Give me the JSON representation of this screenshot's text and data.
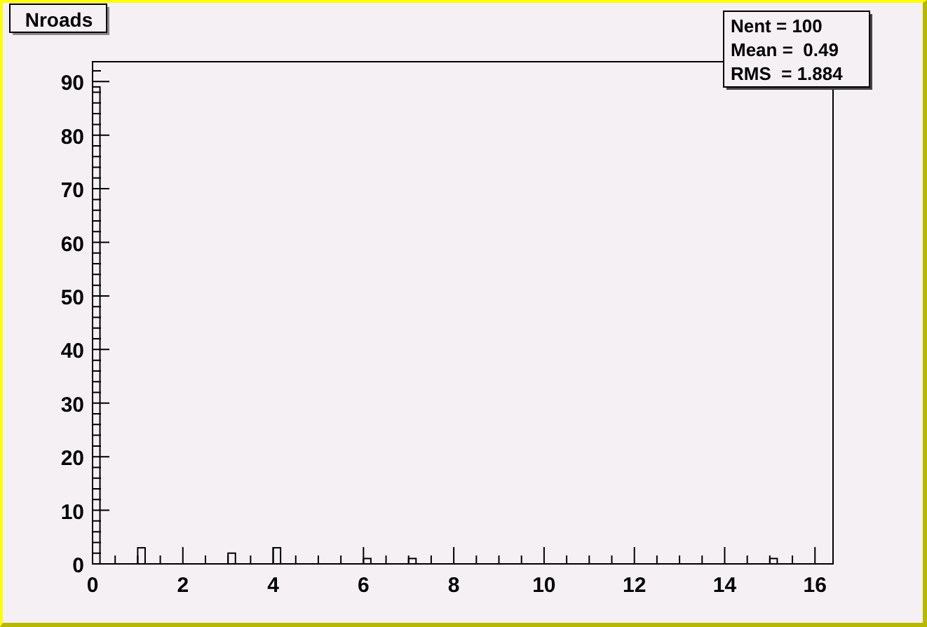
{
  "title": "Nroads",
  "stats": [
    "Nent = 100",
    "Mean =  0.49",
    "RMS  = 1.884"
  ],
  "chart_data": {
    "type": "bar",
    "x": [
      0,
      1,
      3,
      4,
      6,
      7,
      15
    ],
    "values": [
      89,
      3,
      2,
      3,
      1,
      1,
      1
    ],
    "xlim": [
      0,
      16.4
    ],
    "ylim": [
      0,
      93.7
    ],
    "xticks": [
      0,
      2,
      4,
      6,
      8,
      10,
      12,
      14,
      16
    ],
    "yticks": [
      0,
      10,
      20,
      30,
      40,
      50,
      60,
      70,
      80,
      90
    ]
  }
}
